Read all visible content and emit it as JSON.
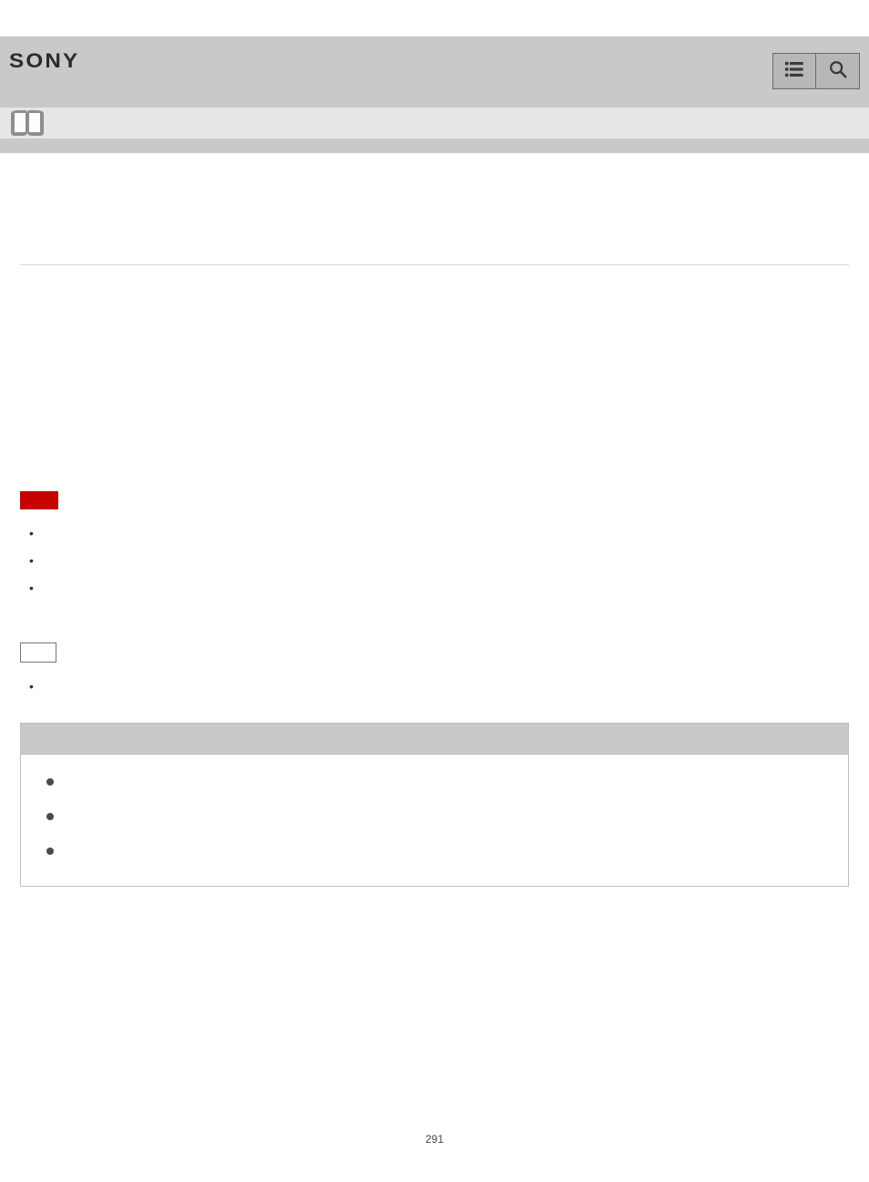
{
  "brand": "SONY",
  "header": {
    "menu_icon": "menu-icon",
    "search_icon": "search-icon"
  },
  "bullets_a": [
    "",
    "",
    ""
  ],
  "bullets_b": [
    ""
  ],
  "panel_bullets": [
    "",
    "",
    ""
  ],
  "page_number": "291"
}
